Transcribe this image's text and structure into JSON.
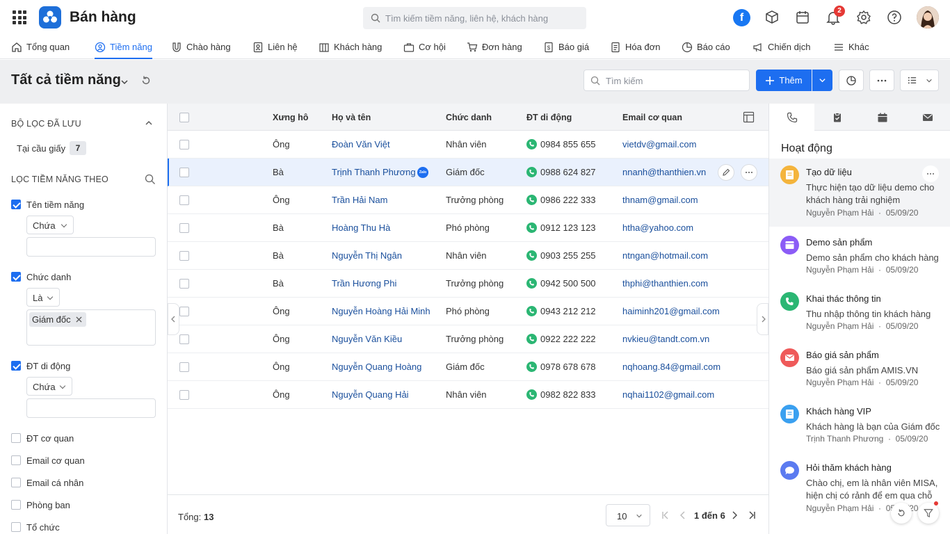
{
  "app": {
    "title": "Bán hàng",
    "search_placeholder": "Tìm kiếm tiềm năng, liên hệ, khách hàng",
    "notif_count": "2",
    "fb_letter": "f"
  },
  "nav": [
    {
      "label": "Tổng quan"
    },
    {
      "label": "Tiềm năng"
    },
    {
      "label": "Chào hàng"
    },
    {
      "label": "Liên hệ"
    },
    {
      "label": "Khách hàng"
    },
    {
      "label": "Cơ hội"
    },
    {
      "label": "Đơn hàng"
    },
    {
      "label": "Báo giá"
    },
    {
      "label": "Hóa đơn"
    },
    {
      "label": "Báo cáo"
    },
    {
      "label": "Chiến dịch"
    },
    {
      "label": "Khác"
    }
  ],
  "page": {
    "title": "Tất cả tiềm năng",
    "search_placeholder": "Tìm kiếm",
    "add_label": "Thêm"
  },
  "filter": {
    "saved_title": "BỘ LỌC ĐÃ LƯU",
    "saved_item": "Tại cầu giấy",
    "saved_count": "7",
    "by_title": "LỌC TIỀM NĂNG THEO",
    "f1": {
      "label": "Tên tiềm năng",
      "op": "Chứa"
    },
    "f2": {
      "label": "Chức danh",
      "op": "Là",
      "tag": "Giám đốc"
    },
    "f3": {
      "label": "ĐT di động",
      "op": "Chứa"
    },
    "others": [
      "ĐT cơ quan",
      "Email cơ quan",
      "Email cá nhân",
      "Phòng ban",
      "Tổ chức"
    ]
  },
  "table": {
    "headers": {
      "salutation": "Xưng hô",
      "name": "Họ và tên",
      "title": "Chức danh",
      "mobile": "ĐT di động",
      "email": "Email cơ quan"
    },
    "rows": [
      {
        "salutation": "Ông",
        "name": "Đoàn Văn Việt",
        "title": "Nhân viên",
        "mobile": "0984 855 655",
        "email": "vietdv@gmail.com"
      },
      {
        "salutation": "Bà",
        "name": "Trịnh Thanh Phương",
        "title": "Giám đốc",
        "mobile": "0988 624 827",
        "email": "nnanh@thanthien.vn"
      },
      {
        "salutation": "Ông",
        "name": "Trần Hải Nam",
        "title": "Trưởng phòng",
        "mobile": "0986 222 333",
        "email": "thnam@gmail.com"
      },
      {
        "salutation": "Bà",
        "name": "Hoàng Thu Hà",
        "title": "Phó phòng",
        "mobile": "0912 123 123",
        "email": "htha@yahoo.com"
      },
      {
        "salutation": "Bà",
        "name": "Nguyễn Thị Ngân",
        "title": "Nhân viên",
        "mobile": "0903 255 255",
        "email": "ntngan@hotmail.com"
      },
      {
        "salutation": "Bà",
        "name": "Trần Hương Phi",
        "title": "Trưởng phòng",
        "mobile": "0942 500 500",
        "email": "thphi@thanthien.com"
      },
      {
        "salutation": "Ông",
        "name": "Nguyễn Hoàng Hải Minh",
        "title": "Phó phòng",
        "mobile": "0943 212 212",
        "email": "haiminh201@gmail.com"
      },
      {
        "salutation": "Ông",
        "name": "Nguyễn Văn Kiều",
        "title": "Trưởng phòng",
        "mobile": "0922 222 222",
        "email": "nvkieu@tandt.com.vn"
      },
      {
        "salutation": "Ông",
        "name": "Nguyễn Quang Hoàng",
        "title": "Giám đốc",
        "mobile": "0978 678 678",
        "email": "nqhoang.84@gmail.com"
      },
      {
        "salutation": "Ông",
        "name": "Nguyễn Quang Hải",
        "title": "Nhân viên",
        "mobile": "0982 822 833",
        "email": "nqhai1102@gmail.com"
      }
    ],
    "zalo_label": "Zalo",
    "total_label": "Tổng:",
    "total": "13",
    "page_size": "10",
    "range": "1 đến 6"
  },
  "activity": {
    "title": "Hoạt động",
    "items": [
      {
        "title": "Tạo dữ liệu",
        "desc": "Thực hiện tạo dữ liệu demo cho khách hàng trải nghiệm",
        "user": "Nguyễn Phạm Hải",
        "date": "05/09/20",
        "color": "#f4b43c"
      },
      {
        "title": "Demo sản phẩm",
        "desc": "Demo sản phẩm cho khách hàng",
        "user": "Nguyễn Phạm Hải",
        "date": "05/09/20",
        "color": "#8b5cf6"
      },
      {
        "title": "Khai thác thông tin",
        "desc": "Thu nhập thông tin khách hàng",
        "user": "Nguyễn Phạm Hải",
        "date": "05/09/20",
        "color": "#2bb673"
      },
      {
        "title": "Báo giá sản phẩm",
        "desc": "Báo giá sản phẩm AMIS.VN",
        "user": "Nguyễn Phạm Hải",
        "date": "05/09/20",
        "color": "#ef5a5a"
      },
      {
        "title": "Khách hàng VIP",
        "desc": "Khách hàng là bạn của Giám đốc",
        "user": "Trịnh Thanh Phương",
        "date": "05/09/20",
        "color": "#3aa0f0"
      },
      {
        "title": "Hỏi thăm khách hàng",
        "desc": "Chào chị, em là nhân viên MISA, hiện chị có rảnh để em qua chỗ",
        "user": "Nguyễn Phạm Hải",
        "date": "05/09/20",
        "color": "#5b7bf0"
      }
    ]
  },
  "colors": {
    "accent": "#1d6ef0",
    "phone": "#2bb673"
  }
}
